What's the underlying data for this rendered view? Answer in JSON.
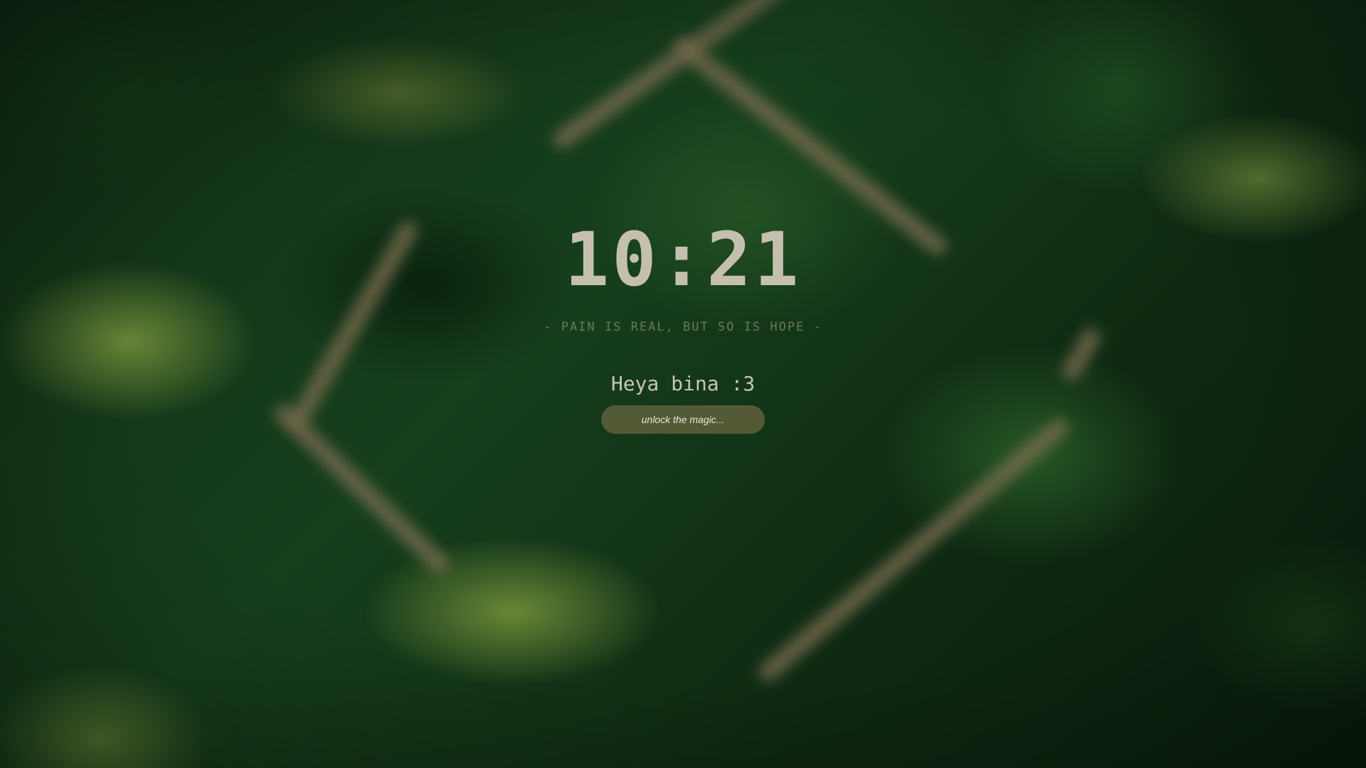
{
  "lockscreen": {
    "clock": {
      "time": "10:21"
    },
    "quote": "- PAIN IS REAL, BUT SO IS HOPE -",
    "greeting": "Heya bina :3",
    "password": {
      "placeholder": "unlock the magic..."
    }
  },
  "colors": {
    "clock": "#c5c0ad",
    "quote": "#6b7a55",
    "greeting": "#c8c4b2",
    "unlock_pill": "#5c603a",
    "background": "#163f1c"
  }
}
